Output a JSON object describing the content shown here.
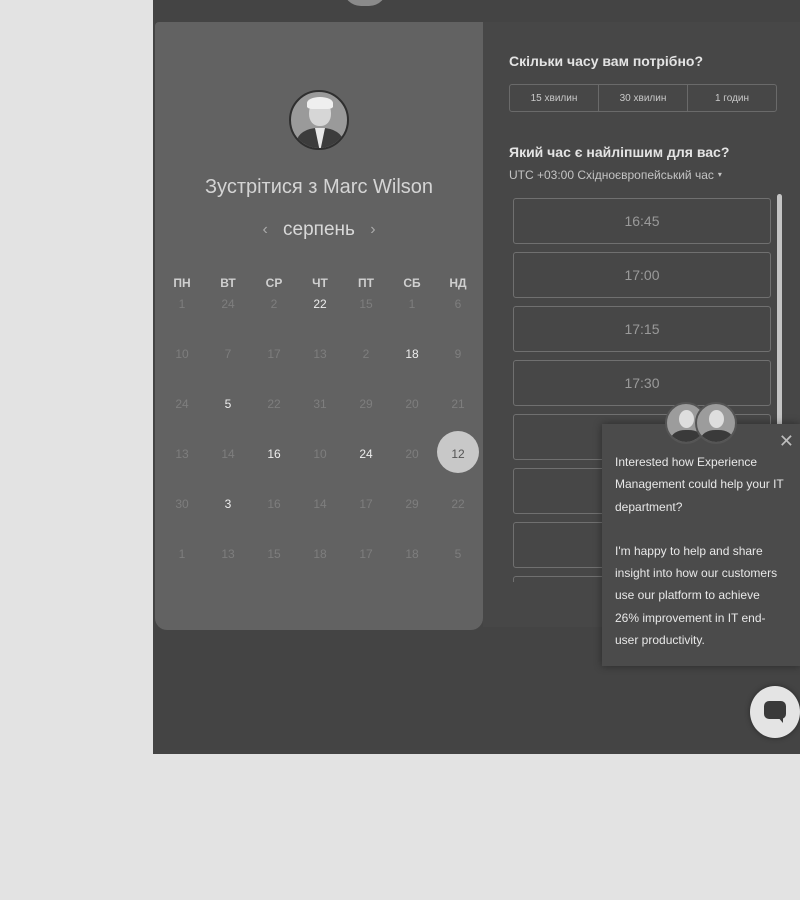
{
  "booking": {
    "meet_title": "Зустрітися з Marc Wilson",
    "month": "серпень",
    "prev_month_icon": "‹",
    "next_month_icon": "›",
    "weekdays": [
      "ПН",
      "ВТ",
      "СР",
      "ЧТ",
      "ПТ",
      "СБ",
      "НД"
    ],
    "weeks": [
      [
        {
          "d": "1",
          "a": false
        },
        {
          "d": "24",
          "a": false
        },
        {
          "d": "2",
          "a": false
        },
        {
          "d": "22",
          "a": true
        },
        {
          "d": "15",
          "a": false
        },
        {
          "d": "1",
          "a": false
        },
        {
          "d": "6",
          "a": false
        }
      ],
      [
        {
          "d": "10",
          "a": false
        },
        {
          "d": "7",
          "a": false
        },
        {
          "d": "17",
          "a": false
        },
        {
          "d": "13",
          "a": false
        },
        {
          "d": "2",
          "a": false
        },
        {
          "d": "18",
          "a": true
        },
        {
          "d": "9",
          "a": false
        }
      ],
      [
        {
          "d": "24",
          "a": false
        },
        {
          "d": "5",
          "a": true
        },
        {
          "d": "22",
          "a": false
        },
        {
          "d": "31",
          "a": false
        },
        {
          "d": "29",
          "a": false
        },
        {
          "d": "20",
          "a": false
        },
        {
          "d": "21",
          "a": false
        }
      ],
      [
        {
          "d": "13",
          "a": false
        },
        {
          "d": "14",
          "a": false
        },
        {
          "d": "16",
          "a": true
        },
        {
          "d": "10",
          "a": false
        },
        {
          "d": "24",
          "a": true
        },
        {
          "d": "20",
          "a": false
        },
        {
          "d": "12",
          "a": true,
          "selected": true
        }
      ],
      [
        {
          "d": "30",
          "a": false
        },
        {
          "d": "3",
          "a": true
        },
        {
          "d": "16",
          "a": false
        },
        {
          "d": "14",
          "a": false
        },
        {
          "d": "17",
          "a": false
        },
        {
          "d": "29",
          "a": false
        },
        {
          "d": "22",
          "a": false
        }
      ],
      [
        {
          "d": "1",
          "a": false
        },
        {
          "d": "13",
          "a": false
        },
        {
          "d": "15",
          "a": false
        },
        {
          "d": "18",
          "a": false
        },
        {
          "d": "17",
          "a": false
        },
        {
          "d": "18",
          "a": false
        },
        {
          "d": "5",
          "a": false
        }
      ]
    ]
  },
  "duration": {
    "question": "Скільки часу вам потрібно?",
    "options": [
      "15 хвилин",
      "30 хвилин",
      "1 годин"
    ]
  },
  "time": {
    "question": "Який час є найліпшим для вас?",
    "timezone": "UTC +03:00 Східноєвропейський час",
    "timezone_caret": "▾",
    "slots": [
      "16:45",
      "17:00",
      "17:15",
      "17:30",
      "",
      "",
      "",
      ""
    ]
  },
  "chat": {
    "close_icon": "✕",
    "message_p1": "Interested how Experience Management could help your IT department?",
    "message_p2": "I'm happy to help and share insight into how our customers use our platform to achieve 26% improvement in IT end-user productivity."
  },
  "colors": {
    "page_bg": "#e3e3e3",
    "frame_bg": "#444444",
    "calendar_panel": "#626262",
    "selected_day": "#c8c8c8"
  }
}
